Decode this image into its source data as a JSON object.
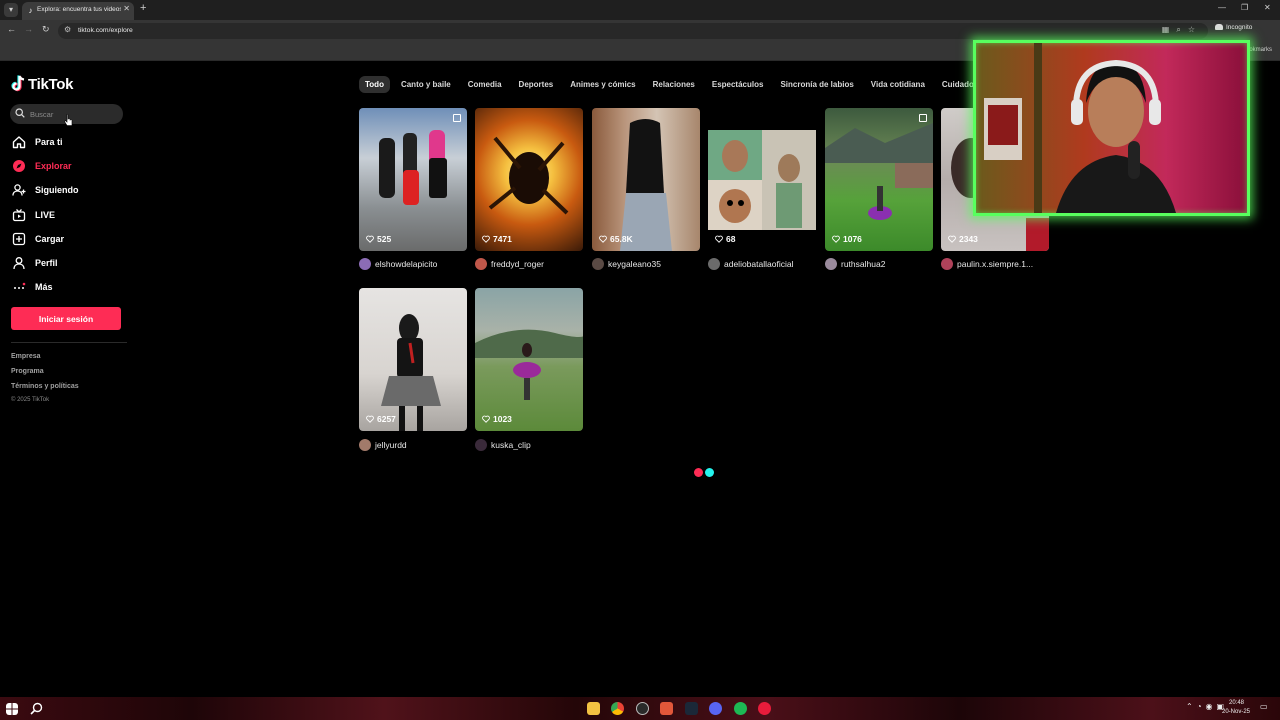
{
  "browser": {
    "tab_title": "Explora: encuentra tus videos fa",
    "url": "tiktok.com/explore",
    "incognito_label": "Incognito",
    "bookmarks_label": "All Bookmarks"
  },
  "sidebar": {
    "logo_text": "TikTok",
    "search_placeholder": "Buscar",
    "nav": [
      {
        "label": "Para ti",
        "icon": "home-icon"
      },
      {
        "label": "Explorar",
        "icon": "compass-icon",
        "active": true
      },
      {
        "label": "Siguiendo",
        "icon": "user-plus-icon"
      },
      {
        "label": "LIVE",
        "icon": "live-tv-icon"
      },
      {
        "label": "Cargar",
        "icon": "upload-icon"
      },
      {
        "label": "Perfil",
        "icon": "profile-icon"
      },
      {
        "label": "Más",
        "icon": "more-icon"
      }
    ],
    "login_label": "Iniciar sesión",
    "footer_links": [
      "Empresa",
      "Programa",
      "Términos y políticas"
    ],
    "copyright": "© 2025 TikTok"
  },
  "categories": [
    "Todo",
    "Canto y baile",
    "Comedia",
    "Deportes",
    "Animes y cómics",
    "Relaciones",
    "Espectáculos",
    "Sincronía de labios",
    "Vida cotidiana",
    "Cuidados de"
  ],
  "videos": [
    {
      "likes": "525",
      "author": "elshowdelapicito"
    },
    {
      "likes": "7471",
      "author": "freddyd_roger"
    },
    {
      "likes": "65.8K",
      "author": "keygaleano35"
    },
    {
      "likes": "68",
      "author": "adeliobatallaoficial"
    },
    {
      "likes": "1076",
      "author": "ruthsalhua2"
    },
    {
      "likes": "2343",
      "author": "paulin.x.siempre.1..."
    },
    {
      "likes": "6257",
      "author": "jellyurdd"
    },
    {
      "likes": "1023",
      "author": "kuska_clip"
    }
  ],
  "taskbar": {
    "time": "20:48",
    "date": "20-Nov-25"
  },
  "colors": {
    "brand_pink": "#fe2c55",
    "brand_cyan": "#25f4ee",
    "webcam_border": "#58ff5e"
  }
}
